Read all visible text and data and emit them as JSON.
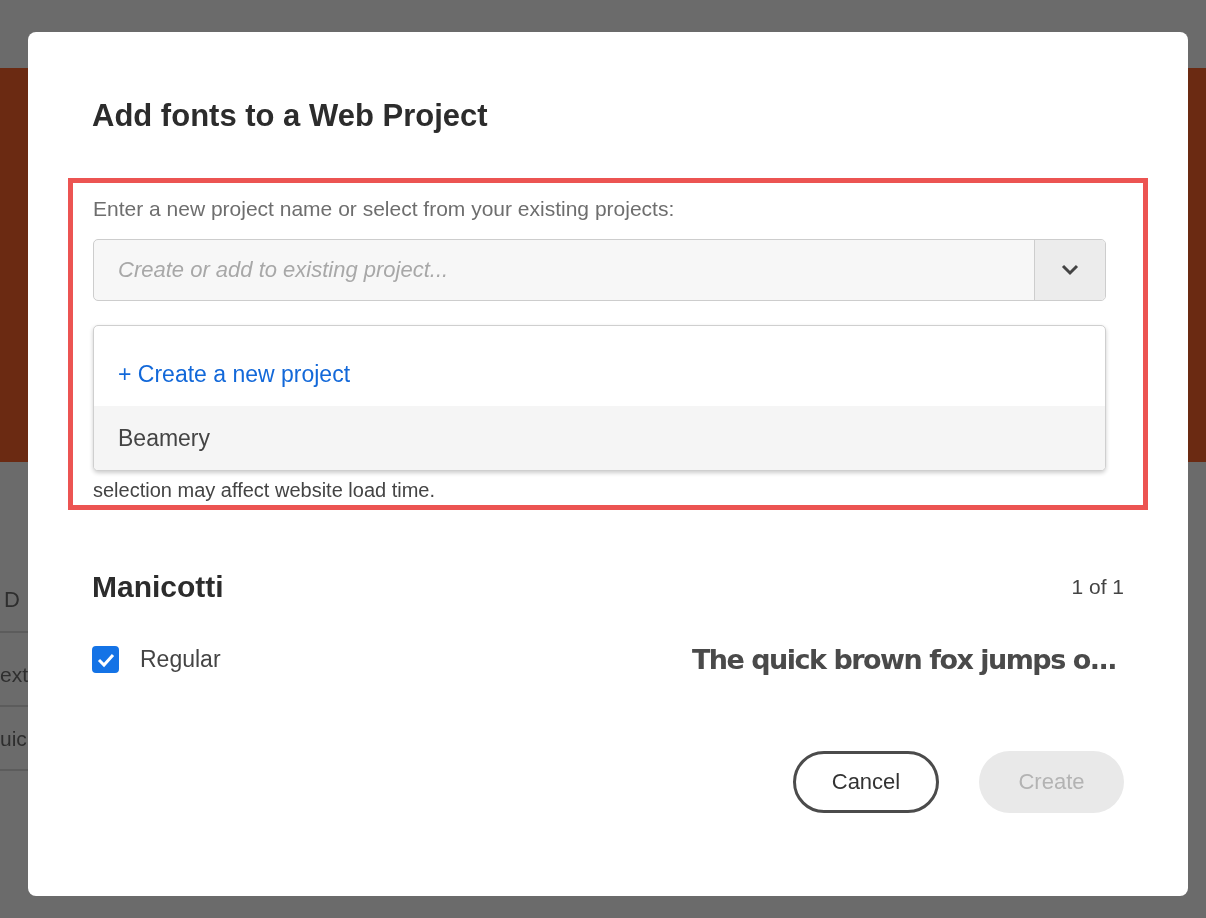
{
  "background": {
    "fragments": [
      "D",
      "ext",
      "uic"
    ]
  },
  "dialog": {
    "title": "Add fonts to a Web Project",
    "highlighted": true,
    "project_field": {
      "label": "Enter a new project name or select from your existing projects:",
      "placeholder": "Create or add to existing project...",
      "expanded": true
    },
    "dropdown_items": [
      {
        "label": "+ Create a new project",
        "kind": "action",
        "selected": false
      },
      {
        "label": "Beamery",
        "kind": "project",
        "selected": true
      }
    ],
    "note": "selection may affect website load time.",
    "family": {
      "name": "Manicotti",
      "count": "1 of 1",
      "styles": [
        {
          "name": "Regular",
          "checked": true,
          "sample": "The quick brown fox jumps o..."
        }
      ]
    },
    "buttons": [
      {
        "label": "Cancel",
        "kind": "secondary",
        "disabled": false
      },
      {
        "label": "Create",
        "kind": "primary",
        "disabled": true
      }
    ]
  }
}
